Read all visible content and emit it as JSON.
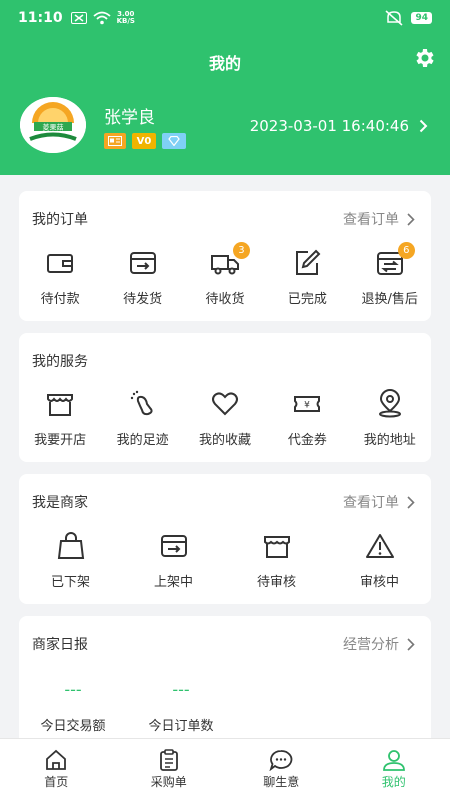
{
  "status_bar": {
    "time": "11:10",
    "speed_value": "3.00",
    "speed_unit": "KB/S",
    "battery": "94"
  },
  "header": {
    "title": "我的",
    "user_name": "张学良",
    "vip_badge": "V0",
    "datetime": "2023-03-01 16:40:46",
    "avatar_text": "菱果菇"
  },
  "orders": {
    "title": "我的订单",
    "link": "查看订单",
    "items": [
      {
        "label": "待付款",
        "icon": "wallet-icon"
      },
      {
        "label": "待发货",
        "icon": "ship-box-icon"
      },
      {
        "label": "待收货",
        "icon": "truck-icon",
        "badge": "3"
      },
      {
        "label": "已完成",
        "icon": "edit-icon"
      },
      {
        "label": "退换/售后",
        "icon": "exchange-icon",
        "badge": "6"
      }
    ]
  },
  "services": {
    "title": "我的服务",
    "items": [
      {
        "label": "我要开店",
        "icon": "shop-icon"
      },
      {
        "label": "我的足迹",
        "icon": "footprint-icon"
      },
      {
        "label": "我的收藏",
        "icon": "heart-icon"
      },
      {
        "label": "代金券",
        "icon": "coupon-icon"
      },
      {
        "label": "我的地址",
        "icon": "location-icon"
      }
    ]
  },
  "merchant": {
    "title": "我是商家",
    "link": "查看订单",
    "items": [
      {
        "label": "已下架",
        "icon": "bag-icon"
      },
      {
        "label": "上架中",
        "icon": "shelf-icon"
      },
      {
        "label": "待审核",
        "icon": "store-icon"
      },
      {
        "label": "审核中",
        "icon": "warning-icon"
      }
    ]
  },
  "report": {
    "title": "商家日报",
    "link": "经营分析",
    "stats": [
      {
        "value": "---",
        "label": "今日交易额"
      },
      {
        "value": "---",
        "label": "今日订单数"
      }
    ]
  },
  "tabbar": {
    "items": [
      {
        "label": "首页",
        "icon": "home-icon"
      },
      {
        "label": "采购单",
        "icon": "clipboard-icon"
      },
      {
        "label": "聊生意",
        "icon": "chat-icon"
      },
      {
        "label": "我的",
        "icon": "user-icon",
        "active": true
      }
    ]
  },
  "colors": {
    "primary": "#2fc26e",
    "badge": "#f5a623"
  }
}
